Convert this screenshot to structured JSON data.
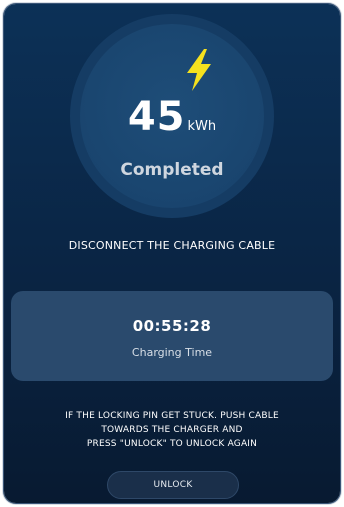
{
  "session": {
    "energy_value": "45",
    "energy_unit": "kWh",
    "status": "Completed",
    "icon": "lightning-bolt-icon",
    "accent_color": "#f5e11e"
  },
  "instruction": "DISCONNECT THE CHARGING CABLE",
  "charging_time": {
    "value": "00:55:28",
    "label": "Charging Time"
  },
  "note_lines": [
    "IF THE LOCKING PIN GET STUCK. PUSH CABLE",
    "TOWARDS THE CHARGER AND",
    "PRESS \"UNLOCK\" TO UNLOCK AGAIN"
  ],
  "unlock_button": {
    "label": "UNLOCK"
  }
}
